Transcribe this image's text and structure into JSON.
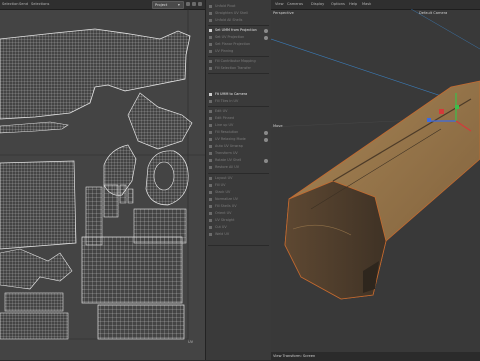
{
  "uv_editor": {
    "menu": [
      "Selection",
      "Send",
      "Selections"
    ],
    "mode_dropdown": "Project",
    "footer_label": "UV"
  },
  "tool_panel": {
    "items": [
      {
        "label": "Unfold Pivot",
        "active": false
      },
      {
        "label": "Straighten UV Shell",
        "active": false
      },
      {
        "label": "Unfold All Shells",
        "active": false
      },
      {
        "label": "Set UMM from Projection",
        "active": true
      },
      {
        "label": "Set UV Projection",
        "active": false
      },
      {
        "label": "Set Planar Projection",
        "active": false
      },
      {
        "label": "UV Pinning",
        "active": false
      },
      {
        "label": "Fill Contributor Mapping",
        "active": false
      },
      {
        "label": "Fill Selection Transfer",
        "active": false
      },
      {
        "label": "Fit UMM to Camera",
        "active": true
      },
      {
        "label": "Fill Tiles in UV",
        "active": false
      },
      {
        "label": "Edit UV",
        "active": false
      },
      {
        "label": "Edit Pinned",
        "active": false
      },
      {
        "label": "Line up UV",
        "active": false
      },
      {
        "label": "Fill Resolution",
        "active": false
      },
      {
        "label": "UV Relaxing Mode",
        "active": false
      },
      {
        "label": "Auto UV Unwrap",
        "active": false
      },
      {
        "label": "Transform UV",
        "active": false
      },
      {
        "label": "Rotate UV Shell",
        "active": false
      },
      {
        "label": "Restore All UV",
        "active": false
      },
      {
        "label": "Layout UV",
        "active": false
      },
      {
        "label": "Fill UV",
        "active": false
      },
      {
        "label": "Stack UV",
        "active": false
      },
      {
        "label": "Normalize UV",
        "active": false
      },
      {
        "label": "Fill Shells UV",
        "active": false
      },
      {
        "label": "Orient UV",
        "active": false
      },
      {
        "label": "UV Straight",
        "active": false
      },
      {
        "label": "Cut UV",
        "active": false
      },
      {
        "label": "Weld UV",
        "active": false
      }
    ]
  },
  "viewport": {
    "menu": [
      "View",
      "Cameras",
      "Display",
      "Options",
      "Help",
      "Mask"
    ],
    "perspective_label": "Perspective",
    "camera_label": "Default Camera",
    "move_label": "Move",
    "footer": "View Transform: Screen",
    "gizmo_colors": {
      "x": "#d33a3a",
      "y": "#3bbf4a",
      "z": "#3d6be0"
    }
  },
  "colors": {
    "uv_background": "#444444",
    "uv_wire": "#dcdcdc",
    "accent_line": "#3b8dd9",
    "stone": "#8c6a42"
  }
}
